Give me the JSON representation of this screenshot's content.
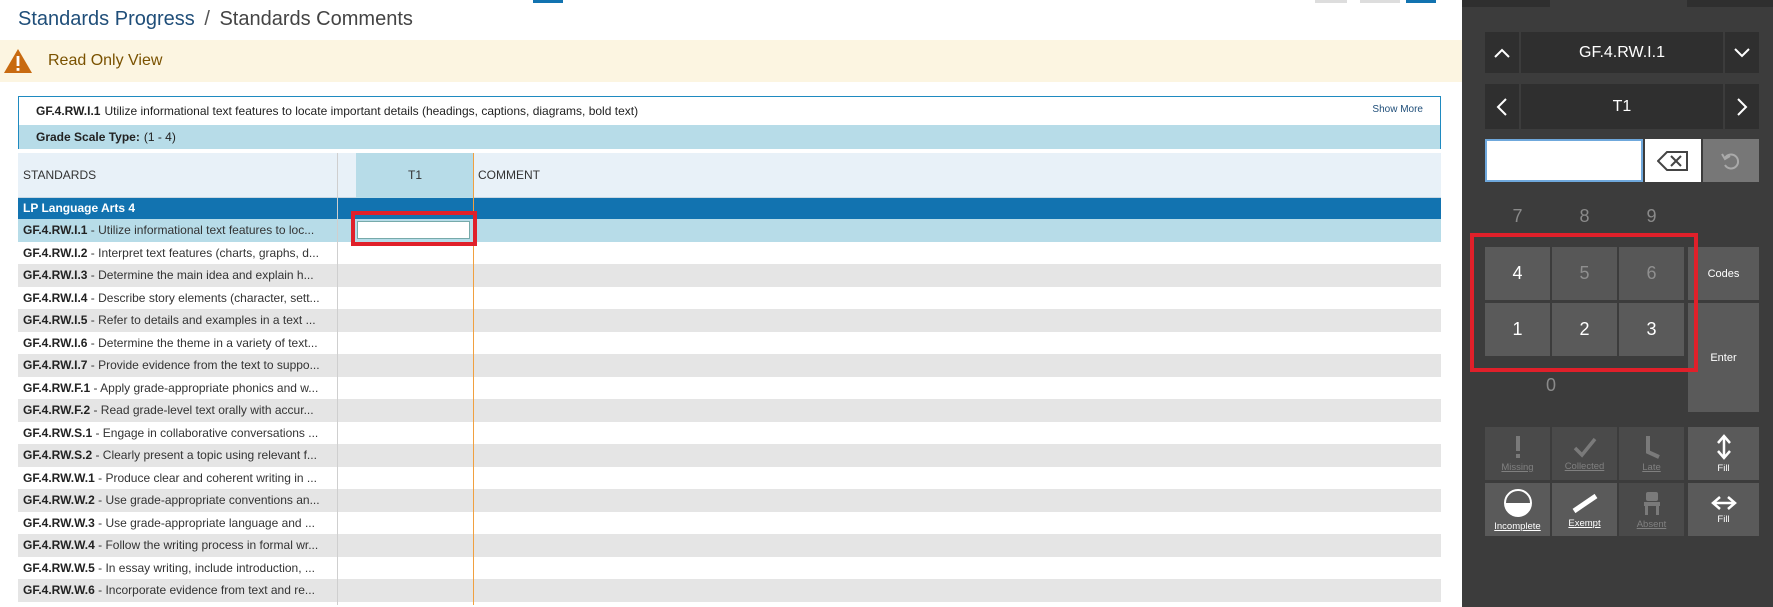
{
  "breadcrumb": {
    "parent": "Standards Progress",
    "separator": "/",
    "current": "Standards Comments"
  },
  "banner": {
    "text": "Read Only View"
  },
  "standard": {
    "code": "GF.4.RW.I.1",
    "description": "Utilize informational text features to locate important details (headings, captions, diagrams, bold text)",
    "show_more": "Show More",
    "scale_label": "Grade Scale Type:",
    "scale_value": "(1 - 4)"
  },
  "grid": {
    "columns": {
      "standards": "STANDARDS",
      "t1": "T1",
      "comment": "COMMENT"
    },
    "group": "LP Language Arts 4",
    "rows": [
      {
        "code": "GF.4.RW.I.1",
        "text": " - Utilize informational text features to loc..."
      },
      {
        "code": "GF.4.RW.I.2",
        "text": " - Interpret text features (charts, graphs, d..."
      },
      {
        "code": "GF.4.RW.I.3",
        "text": " - Determine the main idea and explain h..."
      },
      {
        "code": "GF.4.RW.I.4",
        "text": " - Describe story elements (character, sett..."
      },
      {
        "code": "GF.4.RW.I.5",
        "text": " - Refer to details and examples in a text ..."
      },
      {
        "code": "GF.4.RW.I.6",
        "text": " - Determine the theme in a variety of text..."
      },
      {
        "code": "GF.4.RW.I.7",
        "text": " - Provide evidence from the text to suppo..."
      },
      {
        "code": "GF.4.RW.F.1",
        "text": " - Apply grade-appropriate phonics and w..."
      },
      {
        "code": "GF.4.RW.F.2",
        "text": " - Read grade-level text orally with accur..."
      },
      {
        "code": "GF.4.RW.S.1",
        "text": " - Engage in collaborative conversations ..."
      },
      {
        "code": "GF.4.RW.S.2",
        "text": " - Clearly present a topic using relevant f..."
      },
      {
        "code": "GF.4.RW.W.1",
        "text": " - Produce clear and coherent writing in ..."
      },
      {
        "code": "GF.4.RW.W.2",
        "text": " - Use grade-appropriate conventions an..."
      },
      {
        "code": "GF.4.RW.W.3",
        "text": " - Use grade-appropriate language and ..."
      },
      {
        "code": "GF.4.RW.W.4",
        "text": " - Follow the writing process in formal wr..."
      },
      {
        "code": "GF.4.RW.W.5",
        "text": " - In essay writing, include introduction, ..."
      },
      {
        "code": "GF.4.RW.W.6",
        "text": " - Incorporate evidence from text and re..."
      }
    ]
  },
  "panel": {
    "standard_nav": "GF.4.RW.I.1",
    "term_nav": "T1",
    "keys": {
      "k7": "7",
      "k8": "8",
      "k9": "9",
      "k4": "4",
      "k5": "5",
      "k6": "6",
      "k1": "1",
      "k2": "2",
      "k3": "3",
      "k0": "0"
    },
    "codes": "Codes",
    "enter": "Enter",
    "tools": {
      "missing": "Missing",
      "collected": "Collected",
      "late": "Late",
      "fill_vertical": "Fill",
      "incomplete": "Incomplete",
      "exempt": "Exempt",
      "absent": "Absent",
      "fill_horizontal": "Fill"
    }
  },
  "colors": {
    "accent": "#1273b0",
    "selected_row": "#b7dce8",
    "highlight": "#e0202a",
    "panel_bg": "#3c3c3c"
  }
}
